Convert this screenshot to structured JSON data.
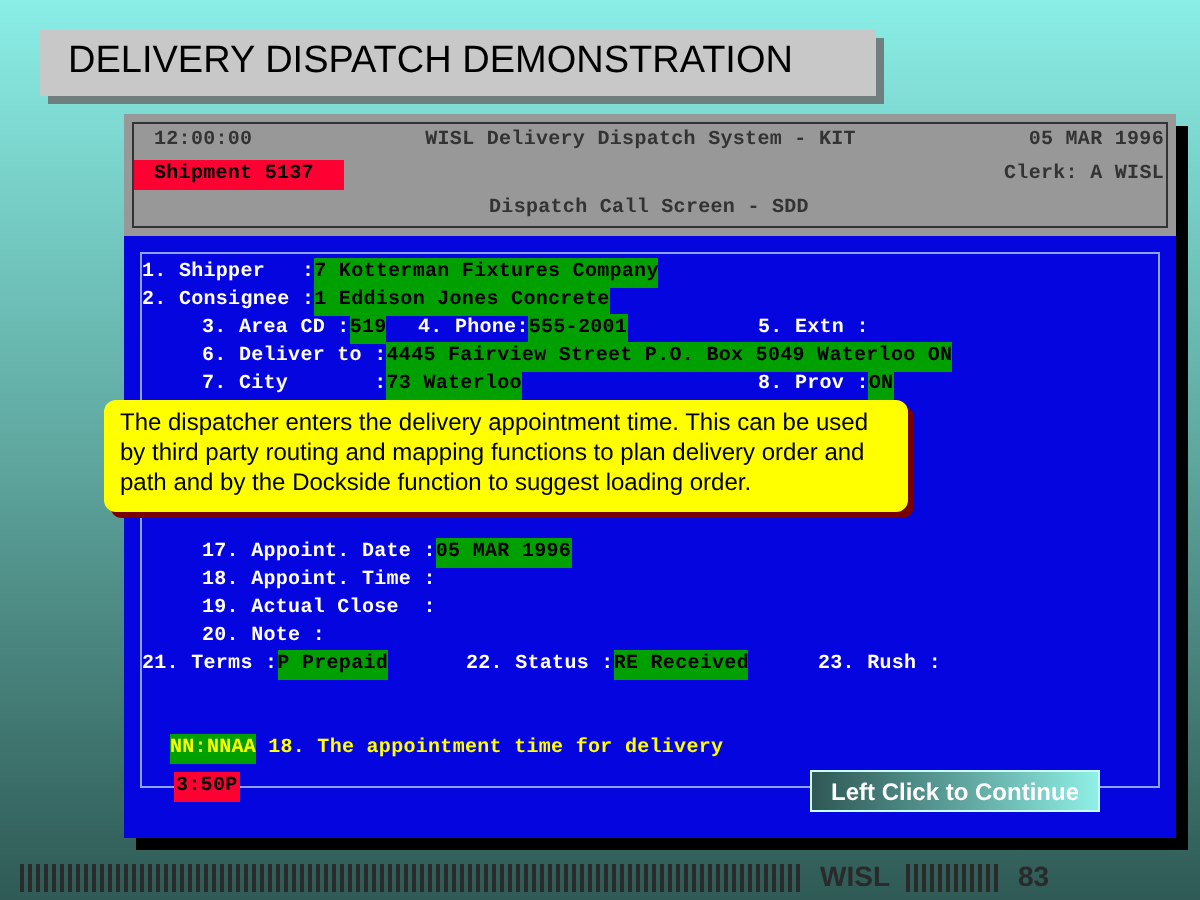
{
  "slide_title": "DELIVERY DISPATCH DEMONSTRATION",
  "header": {
    "time": "12:00:00",
    "system_title": "WISL Delivery Dispatch System - KIT",
    "date": "05 MAR 1996",
    "shipment": "Shipment 5137",
    "clerk": "Clerk: A WISL",
    "screen_title": "Dispatch Call Screen - SDD"
  },
  "form_rows": [
    {
      "kind": "main",
      "fields": [
        {
          "label": "1. Shipper   :",
          "value": "7 Kotterman Fixtures Company"
        }
      ]
    },
    {
      "kind": "main",
      "fields": [
        {
          "label": "2. Consignee :",
          "value": "1 Eddison Jones Concrete"
        }
      ]
    },
    {
      "kind": "sub",
      "fields": [
        {
          "label": "3. Area CD :",
          "value": "519"
        },
        {
          "label": "4. Phone:",
          "value": "555-2001"
        },
        {
          "label": "5. Extn :"
        }
      ]
    },
    {
      "kind": "sub",
      "fields": [
        {
          "label": "6. Deliver to :",
          "value": "4445 Fairview Street P.O. Box 5049 Waterloo ON"
        }
      ]
    },
    {
      "kind": "sub_wide",
      "fields": [
        {
          "label": "7. City       :",
          "value": "73 Waterloo"
        },
        {
          "label": "8. Prov :",
          "value": "ON"
        }
      ]
    },
    {
      "kind": "hidden"
    },
    {
      "kind": "hidden"
    },
    {
      "kind": "hidden"
    },
    {
      "kind": "hidden"
    },
    {
      "kind": "hidden"
    },
    {
      "kind": "sub",
      "fields": [
        {
          "label": "17. Appoint. Date :",
          "value": "05 MAR 1996"
        }
      ]
    },
    {
      "kind": "sub",
      "fields": [
        {
          "label": "18. Appoint. Time :"
        }
      ]
    },
    {
      "kind": "sub",
      "fields": [
        {
          "label": "19. Actual Close  :"
        }
      ]
    },
    {
      "kind": "sub",
      "fields": [
        {
          "label": "20. Note :"
        }
      ]
    },
    {
      "kind": "terms",
      "fields": [
        {
          "label": "21. Terms :",
          "value": "P Prepaid"
        },
        {
          "label": "22. Status :",
          "value": "RE Received"
        },
        {
          "label": "23. Rush :"
        }
      ]
    }
  ],
  "callout": "The dispatcher enters the delivery appointment time. This can be used by third party routing and mapping functions to plan delivery order and path and by the Dockside function to suggest loading order.",
  "hint": {
    "format": "NN:NNAA",
    "text": "18. The appointment time for delivery"
  },
  "entry": "3:50P",
  "continue_button": "Left Click to Continue",
  "footer": {
    "brand": "WISL",
    "page": "83"
  }
}
